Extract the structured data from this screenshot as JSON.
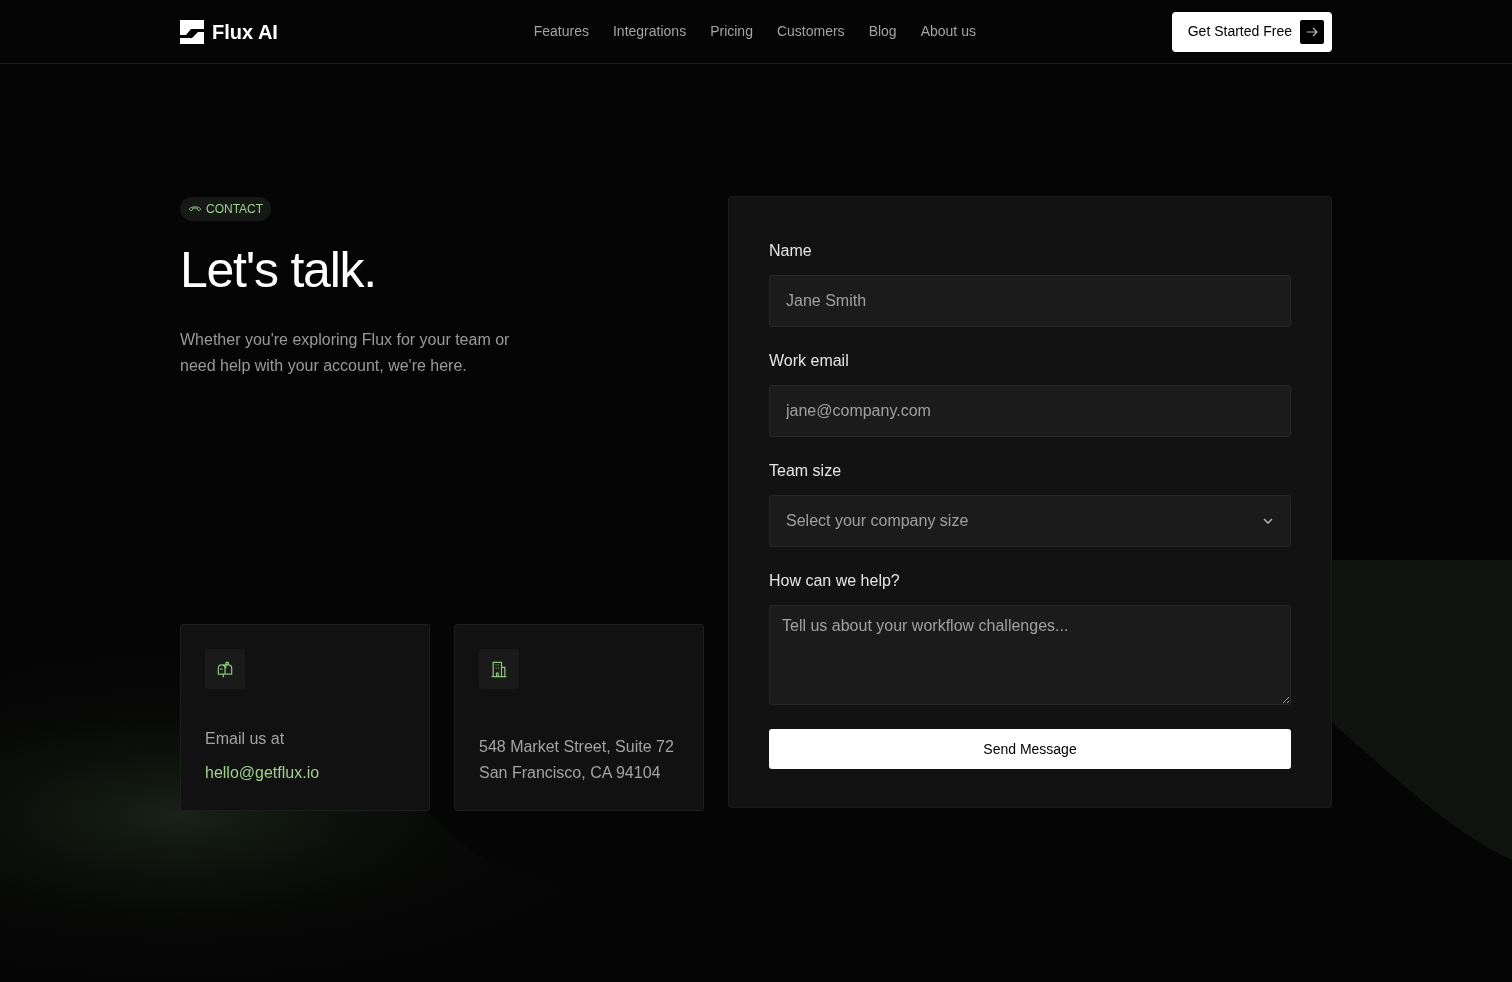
{
  "nav": {
    "brand": "Flux AI",
    "links": [
      "Features",
      "Integrations",
      "Pricing",
      "Customers",
      "Blog",
      "About us"
    ],
    "cta": "Get Started Free"
  },
  "hero": {
    "badge": "CONTACT",
    "title": "Let's talk.",
    "subtitle": "Whether you're exploring Flux for your team or need help with your account, we're here."
  },
  "cards": [
    {
      "kind": "email",
      "lines": [
        "Email us at"
      ],
      "link": "hello@getflux.io"
    },
    {
      "kind": "address",
      "lines": [
        "548 Market Street, Suite 72",
        "San Francisco, CA 94104"
      ]
    }
  ],
  "form": {
    "fields": [
      {
        "kind": "text",
        "label": "Name",
        "placeholder": "Jane Smith"
      },
      {
        "kind": "text",
        "label": "Work email",
        "placeholder": "jane@company.com"
      },
      {
        "kind": "select",
        "label": "Team size",
        "placeholder": "Select your company size"
      },
      {
        "kind": "textarea",
        "label": "How can we help?",
        "placeholder": "Tell us about your workflow challenges..."
      }
    ],
    "submit": "Send Message"
  }
}
